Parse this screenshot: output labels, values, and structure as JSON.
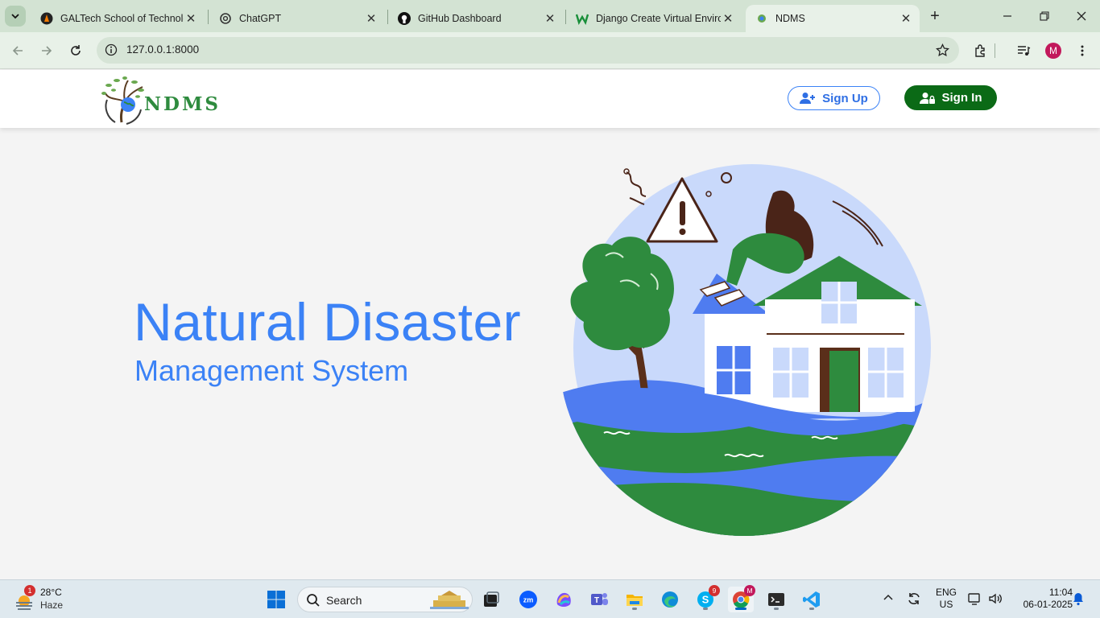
{
  "browser": {
    "tabs": [
      {
        "title": "GALTech School of Technology",
        "icon": "galtech-favicon",
        "active": false
      },
      {
        "title": "ChatGPT",
        "icon": "chatgpt-favicon",
        "active": false
      },
      {
        "title": "GitHub Dashboard",
        "icon": "github-favicon",
        "active": false
      },
      {
        "title": "Django Create Virtual Environment",
        "icon": "w-favicon",
        "active": false
      },
      {
        "title": "NDMS",
        "icon": "ndms-favicon",
        "active": true
      }
    ],
    "url": "127.0.0.1:8000",
    "profile_initial": "M"
  },
  "site": {
    "logo_text": "NDMS",
    "signup_label": "Sign Up",
    "signin_label": "Sign In",
    "hero_title": "Natural Disaster",
    "hero_subtitle": "Management System"
  },
  "taskbar": {
    "weather": {
      "temp": "28°C",
      "condition": "Haze",
      "badge": "1"
    },
    "search_label": "Search",
    "skype_badge": "9",
    "chrome_badge": "M",
    "lang_top": "ENG",
    "lang_bottom": "US",
    "time": "11:04",
    "date": "06-01-2025"
  },
  "colors": {
    "accent_blue": "#3b82f6",
    "brand_green": "#0b6a16",
    "tabbar_bg": "#d3e3d3"
  }
}
